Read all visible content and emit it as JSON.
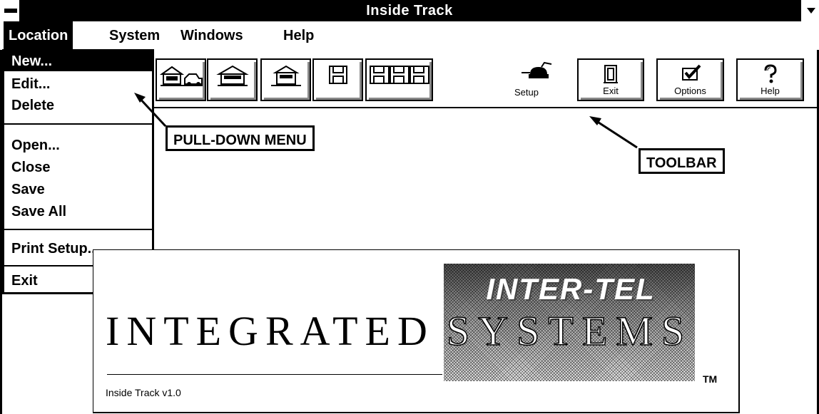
{
  "window": {
    "title": "Inside Track"
  },
  "menubar": {
    "items": [
      {
        "label": "Location"
      },
      {
        "label": "System"
      },
      {
        "label": "Windows"
      },
      {
        "label": "Help"
      }
    ]
  },
  "location_menu": {
    "items": [
      "New...",
      "Edit...",
      "Delete",
      "Open...",
      "Close",
      "Save",
      "Save All",
      "Print Setup...",
      "Exit"
    ]
  },
  "toolbar": {
    "buttons": [
      {
        "icon": "house-car-icon",
        "label": ""
      },
      {
        "icon": "house-icon",
        "label": ""
      },
      {
        "icon": "building-icon",
        "label": ""
      },
      {
        "icon": "floppy-disk-icon",
        "label": ""
      },
      {
        "icon": "save-all-icon",
        "label": ""
      },
      {
        "icon": "phone-icon",
        "label": "Setup"
      },
      {
        "icon": "door-icon",
        "label": "Exit"
      },
      {
        "icon": "checkbox-icon",
        "label": "Options"
      },
      {
        "icon": "question-icon",
        "label": "Help"
      }
    ]
  },
  "callouts": {
    "pulldown": "PULL-DOWN MENU",
    "toolbar": "TOOLBAR"
  },
  "splash": {
    "word_left": "INTEGRATED",
    "word_right": "SYSTEMS",
    "brand": "INTER-TEL",
    "tm": "TM",
    "version": "Inside Track v1.0"
  }
}
